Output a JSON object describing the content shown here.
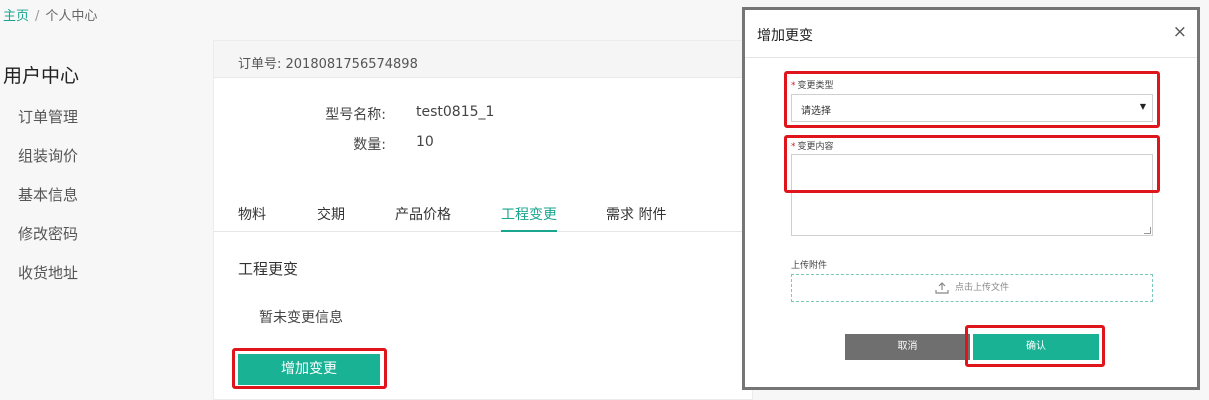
{
  "breadcrumb": {
    "home": "主页",
    "separator": "/",
    "current": "个人中心"
  },
  "sidebar": {
    "title": "用户中心",
    "items": [
      {
        "label": "订单管理"
      },
      {
        "label": "组装询价"
      },
      {
        "label": "基本信息"
      },
      {
        "label": "修改密码"
      },
      {
        "label": "收货地址"
      }
    ]
  },
  "order": {
    "number_text": "订单号: 2018081756574898",
    "model_label": "型号名称:",
    "model_value": "test0815_1",
    "qty_label": "数量:",
    "qty_value": "10"
  },
  "tabs": [
    {
      "label": "物料"
    },
    {
      "label": "交期"
    },
    {
      "label": "产品价格"
    },
    {
      "label": "工程变更",
      "active": true
    },
    {
      "label": "需求 附件"
    }
  ],
  "engineering": {
    "title": "工程更变",
    "empty": "暂未变更信息",
    "add_button": "增加变更"
  },
  "modal": {
    "title": "增加更变",
    "close": "×",
    "type_label": "变更类型",
    "type_required": "*",
    "type_value": "请选择",
    "content_label": "变更内容",
    "content_required": "*",
    "attach_label": "上传附件",
    "upload_text": "点击上传文件",
    "cancel_button": "取消",
    "confirm_button": "确认"
  },
  "colors": {
    "accent": "#19b295",
    "highlight": "#e0151c",
    "cancel": "#6f6f6f"
  },
  "icons": {
    "close": "close-icon",
    "upload": "upload-icon",
    "dropdown": "chevron-down-icon"
  }
}
